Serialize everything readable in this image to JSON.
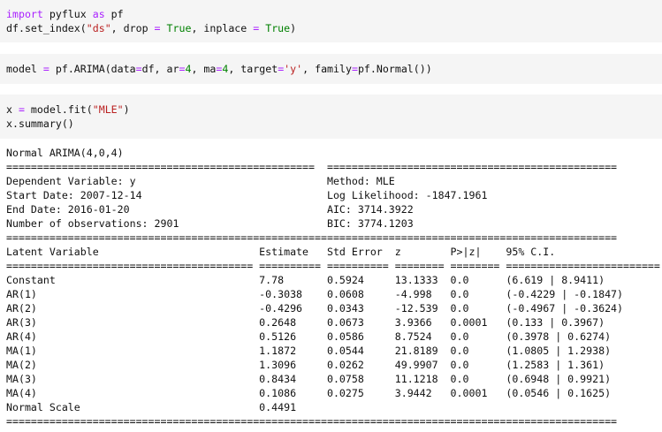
{
  "cells": {
    "c1": {
      "l1": {
        "a": "import",
        "b": " pyflux ",
        "c": "as",
        "d": " pf"
      },
      "l2": {
        "a": "df.set_index(",
        "b": "\"ds\"",
        "c": ", drop ",
        "d": "=",
        "e": " ",
        "f": "True",
        "g": ", inplace ",
        "h": "=",
        "i": " ",
        "j": "True",
        "k": ")"
      }
    },
    "c2": {
      "l1": {
        "a": "model ",
        "b": "=",
        "c": " pf.ARIMA(data",
        "d": "=",
        "e": "df, ar",
        "f": "=",
        "g": "4",
        "h": ", ma",
        "i": "=",
        "j": "4",
        "k": ", target",
        "l": "=",
        "m": "'y'",
        "n": ", family",
        "o": "=",
        "p": "pf.Normal())"
      }
    },
    "c3": {
      "l1": {
        "a": "x ",
        "b": "=",
        "c": " model.fit(",
        "d": "\"MLE\"",
        "e": ")"
      },
      "l2": {
        "a": "x.summary()"
      }
    }
  },
  "output": {
    "title": "Normal ARIMA(4,0,4)",
    "rule_eq_top": "==================================================  ===============================================",
    "info": [
      "Dependent Variable: y                               Method: MLE",
      "Start Date: 2007-12-14                              Log Likelihood: -1847.1961",
      "End Date: 2016-01-20                                AIC: 3714.3922",
      "Number of observations: 2901                        BIC: 3774.1203"
    ],
    "rule_full": "===================================================================================================",
    "header": "Latent Variable                          Estimate   Std Error  z        P>|z|    95% C.I.",
    "rule_cols": "======================================== ========== ========== ======== ======== =========================",
    "rows": [
      "Constant                                 7.78       0.5924     13.1333  0.0      (6.619 | 8.9411)",
      "AR(1)                                    -0.3038    0.0608     -4.998   0.0      (-0.4229 | -0.1847)",
      "AR(2)                                    -0.4296    0.0343     -12.539  0.0      (-0.4967 | -0.3624)",
      "AR(3)                                    0.2648     0.0673     3.9366   0.0001   (0.133 | 0.3967)",
      "AR(4)                                    0.5126     0.0586     8.7524   0.0      (0.3978 | 0.6274)",
      "MA(1)                                    1.1872     0.0544     21.8189  0.0      (1.0805 | 1.2938)",
      "MA(2)                                    1.3096     0.0262     49.9907  0.0      (1.2583 | 1.361)",
      "MA(3)                                    0.8434     0.0758     11.1218  0.0      (0.6948 | 0.9921)",
      "MA(4)                                    0.1086     0.0275     3.9442   0.0001   (0.0546 | 0.1625)",
      "Normal Scale                             0.4491"
    ],
    "rule_bottom": "==================================================================================================="
  }
}
